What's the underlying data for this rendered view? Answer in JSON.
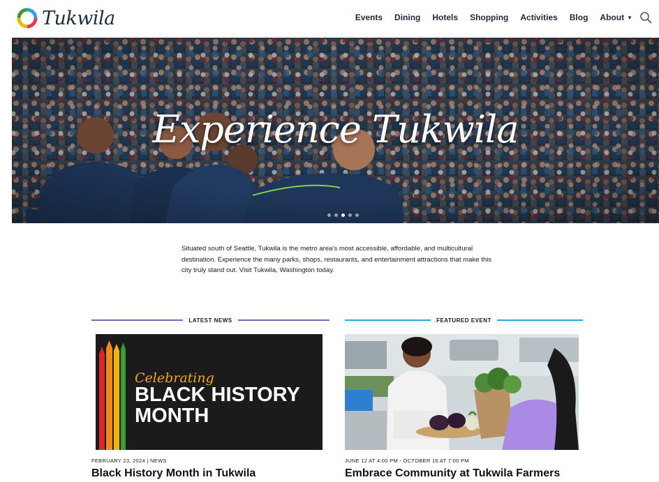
{
  "site": {
    "logo_text": "Tukwila"
  },
  "nav": {
    "items": [
      "Events",
      "Dining",
      "Hotels",
      "Shopping",
      "Activities",
      "Blog",
      "About"
    ],
    "search_icon": "search-icon"
  },
  "hero": {
    "title": "Experience Tukwila",
    "slide_count": 5,
    "active_slide": 2
  },
  "intro": {
    "text": "Situated south of Seattle, Tukwila is the metro area’s most accessible, affordable, and multicultural destination. Experience the many parks, shops, restaurants, and entertainment attractions that make this city truly stand out. Visit Tukwila, Washington today."
  },
  "news": {
    "section_label": "LATEST NEWS",
    "accent": "#7a68b3",
    "image_text_1": "Celebrating",
    "image_text_2": "BLACK HISTORY",
    "image_text_3": "MONTH",
    "meta": "FEBRUARY 23, 2024 | NEWS",
    "title": "Black History Month in Tukwila"
  },
  "event": {
    "section_label": "FEATURED EVENT",
    "accent": "#2ba6de",
    "meta": "JUNE 12 AT 4:00 PM - OCTOBER 16 AT 7:00 PM",
    "title": "Embrace Community at Tukwila Farmers"
  },
  "colors": {
    "stripe_red": "#d62828",
    "stripe_orange": "#f08a1c",
    "stripe_yellow": "#f2b705",
    "stripe_green": "#3a9b3a"
  }
}
